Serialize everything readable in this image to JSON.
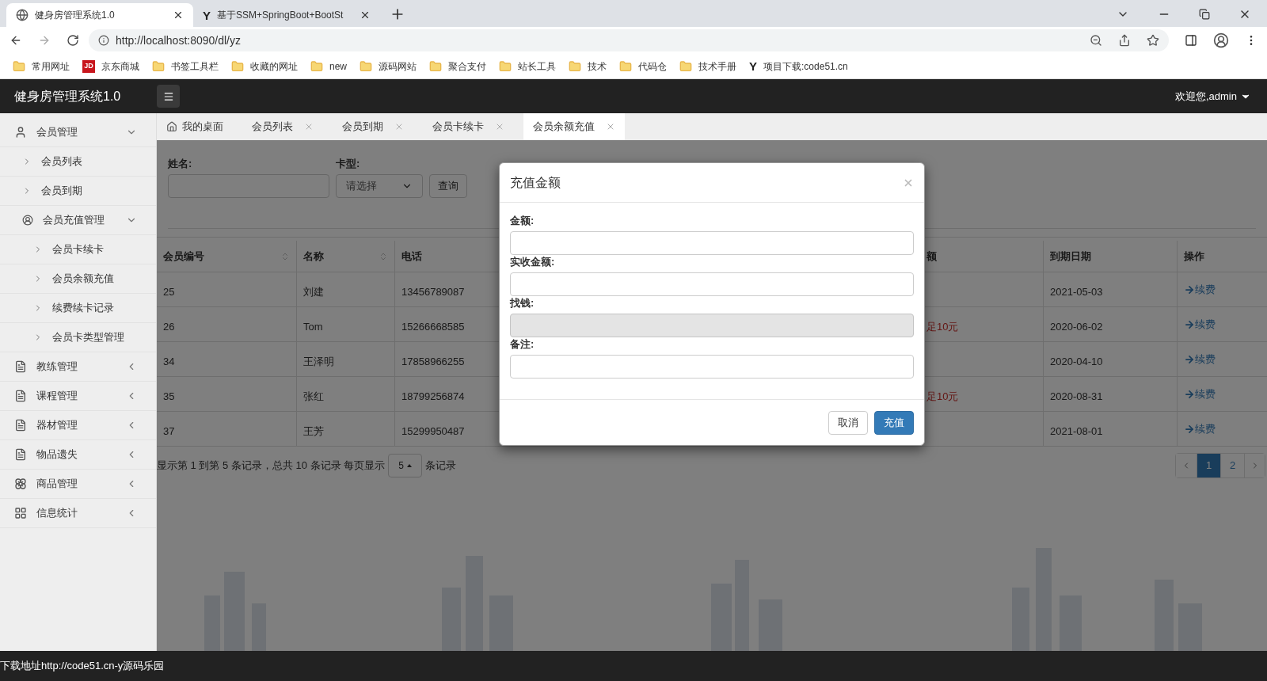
{
  "browser": {
    "tabs": [
      {
        "title": "健身房管理系统1.0",
        "selected": true,
        "kind": "globe"
      },
      {
        "title": "基于SSM+SpringBoot+BootSt",
        "selected": false,
        "kind": "logo",
        "logo_text": "Y"
      }
    ],
    "url": "http://localhost:8090/dl/yz",
    "bookmarks": [
      {
        "label": "常用网址",
        "kind": "folder"
      },
      {
        "label": "京东商城",
        "kind": "logo",
        "logo_text": "JD"
      },
      {
        "label": "书签工具栏",
        "kind": "folder"
      },
      {
        "label": "收藏的网址",
        "kind": "folder"
      },
      {
        "label": "new",
        "kind": "folder"
      },
      {
        "label": "源码网站",
        "kind": "folder"
      },
      {
        "label": "聚合支付",
        "kind": "folder"
      },
      {
        "label": "站长工具",
        "kind": "folder"
      },
      {
        "label": "技术",
        "kind": "folder"
      },
      {
        "label": "代码仓",
        "kind": "folder"
      },
      {
        "label": "技术手册",
        "kind": "folder"
      },
      {
        "label": "项目下载:code51.cn",
        "kind": "ylogo",
        "logo_text": "Y"
      }
    ]
  },
  "header": {
    "title": "健身房管理系统1.0",
    "user": "欢迎您,admin"
  },
  "sidebar": {
    "items": [
      {
        "label": "会员管理",
        "expanded": true,
        "children": [
          {
            "label": "会员列表"
          },
          {
            "label": "会员到期"
          },
          {
            "label": "会员充值管理",
            "expanded": true,
            "children": [
              {
                "label": "会员卡续卡"
              },
              {
                "label": "会员余额充值"
              },
              {
                "label": "续费续卡记录"
              },
              {
                "label": "会员卡类型管理"
              }
            ]
          }
        ]
      },
      {
        "label": "教练管理",
        "expanded": false
      },
      {
        "label": "课程管理",
        "expanded": false
      },
      {
        "label": "器材管理",
        "expanded": false
      },
      {
        "label": "物品遗失",
        "expanded": false
      },
      {
        "label": "商品管理",
        "expanded": false
      },
      {
        "label": "信息统计",
        "expanded": false
      }
    ]
  },
  "tabs": [
    {
      "label": "我的桌面",
      "kind": "home",
      "selected": false
    },
    {
      "label": "会员列表",
      "kind": "page",
      "selected": false
    },
    {
      "label": "会员到期",
      "kind": "page",
      "selected": false
    },
    {
      "label": "会员卡续卡",
      "kind": "page",
      "selected": false
    },
    {
      "label": "会员余额充值",
      "kind": "page",
      "selected": true
    }
  ],
  "search": {
    "name_label": "姓名:",
    "card_label": "卡型:",
    "card_value": "请选择",
    "button": "查询"
  },
  "table": {
    "columns": [
      {
        "label": "会员编号",
        "sortable": true
      },
      {
        "label": "名称",
        "sortable": true
      },
      {
        "label": "电话",
        "sortable": false
      },
      {
        "label": "额",
        "sortable": false
      },
      {
        "label": "到期日期",
        "sortable": false
      },
      {
        "label": "操作",
        "sortable": false
      }
    ],
    "rows": [
      {
        "id": "25",
        "name": "刘建",
        "phone": "13456789087",
        "column_5": null,
        "expiry": "2021-05-03",
        "action": "续费"
      },
      {
        "id": "26",
        "name": "Tom",
        "phone": "15266668585",
        "column_5": "足10元",
        "expiry": "2020-06-02",
        "action": "续费"
      },
      {
        "id": "34",
        "name": "王泽明",
        "phone": "17858966255",
        "column_5": null,
        "expiry": "2020-04-10",
        "action": "续费"
      },
      {
        "id": "35",
        "name": "张红",
        "phone": "18799256874",
        "column_5": "足10元",
        "expiry": "2020-08-31",
        "action": "续费"
      },
      {
        "id": "37",
        "name": "王芳",
        "phone": "15299950487",
        "column_5": null,
        "expiry": "2021-08-01",
        "action": "续费"
      }
    ]
  },
  "pagination": {
    "summary": "显示第 1 到第 5 条记录，总共 10 条记录 每页显示",
    "page_size": "5",
    "suffix": "条记录",
    "pages": [
      {
        "label": "1",
        "selected": true
      },
      {
        "label": "2",
        "selected": false
      }
    ]
  },
  "dialog": {
    "title": "充值金额",
    "fields": [
      {
        "label": "金额:",
        "disabled": false
      },
      {
        "label": "实收金额:",
        "disabled": false
      },
      {
        "label": "找钱:",
        "disabled": true
      },
      {
        "label": "备注:",
        "disabled": false
      }
    ],
    "buttons": [
      {
        "label": "取消",
        "primary": false
      },
      {
        "label": "充值",
        "primary": true
      }
    ]
  },
  "status_bar": "下载地址http://code51.cn-y源码乐园"
}
